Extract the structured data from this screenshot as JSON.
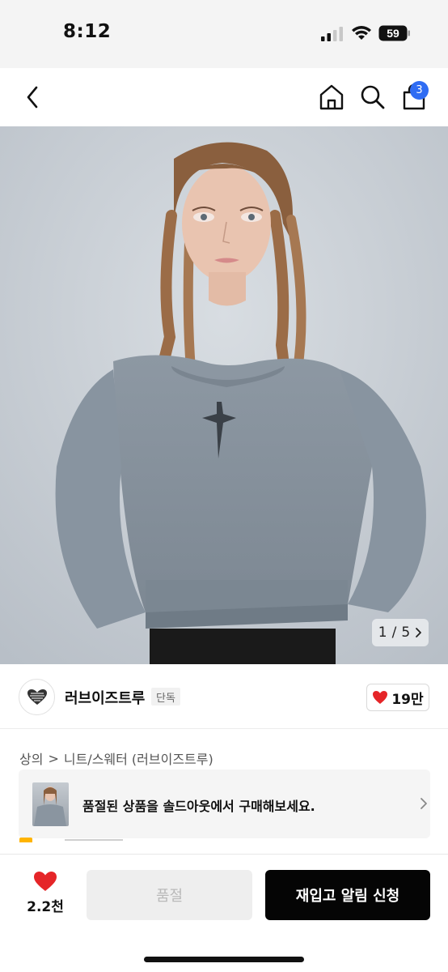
{
  "status_bar": {
    "time": "8:12",
    "battery": "59"
  },
  "nav": {
    "cart_count": "3"
  },
  "gallery": {
    "current": "1",
    "separator": "/",
    "total": "5"
  },
  "brand": {
    "name": "러브이즈트루",
    "tag": "단독",
    "likes": "19만"
  },
  "breadcrumb": {
    "category": "상의",
    "separator": ">",
    "subcategory": "니트/스웨터 (러브이즈트루)"
  },
  "soldout_banner": {
    "text": "품절된 상품을 솔드아웃에서 구매해보세요."
  },
  "bottom_bar": {
    "wish_count": "2.2천",
    "soldout_label": "품절",
    "restock_label": "재입고 알림 신청"
  },
  "colors": {
    "accent_red": "#e52528",
    "badge_blue": "#2f6cf3",
    "primary_black": "#050505"
  },
  "icons": [
    "back-icon",
    "home-icon",
    "search-icon",
    "cart-icon",
    "heart-icon",
    "chevron-right-icon"
  ]
}
